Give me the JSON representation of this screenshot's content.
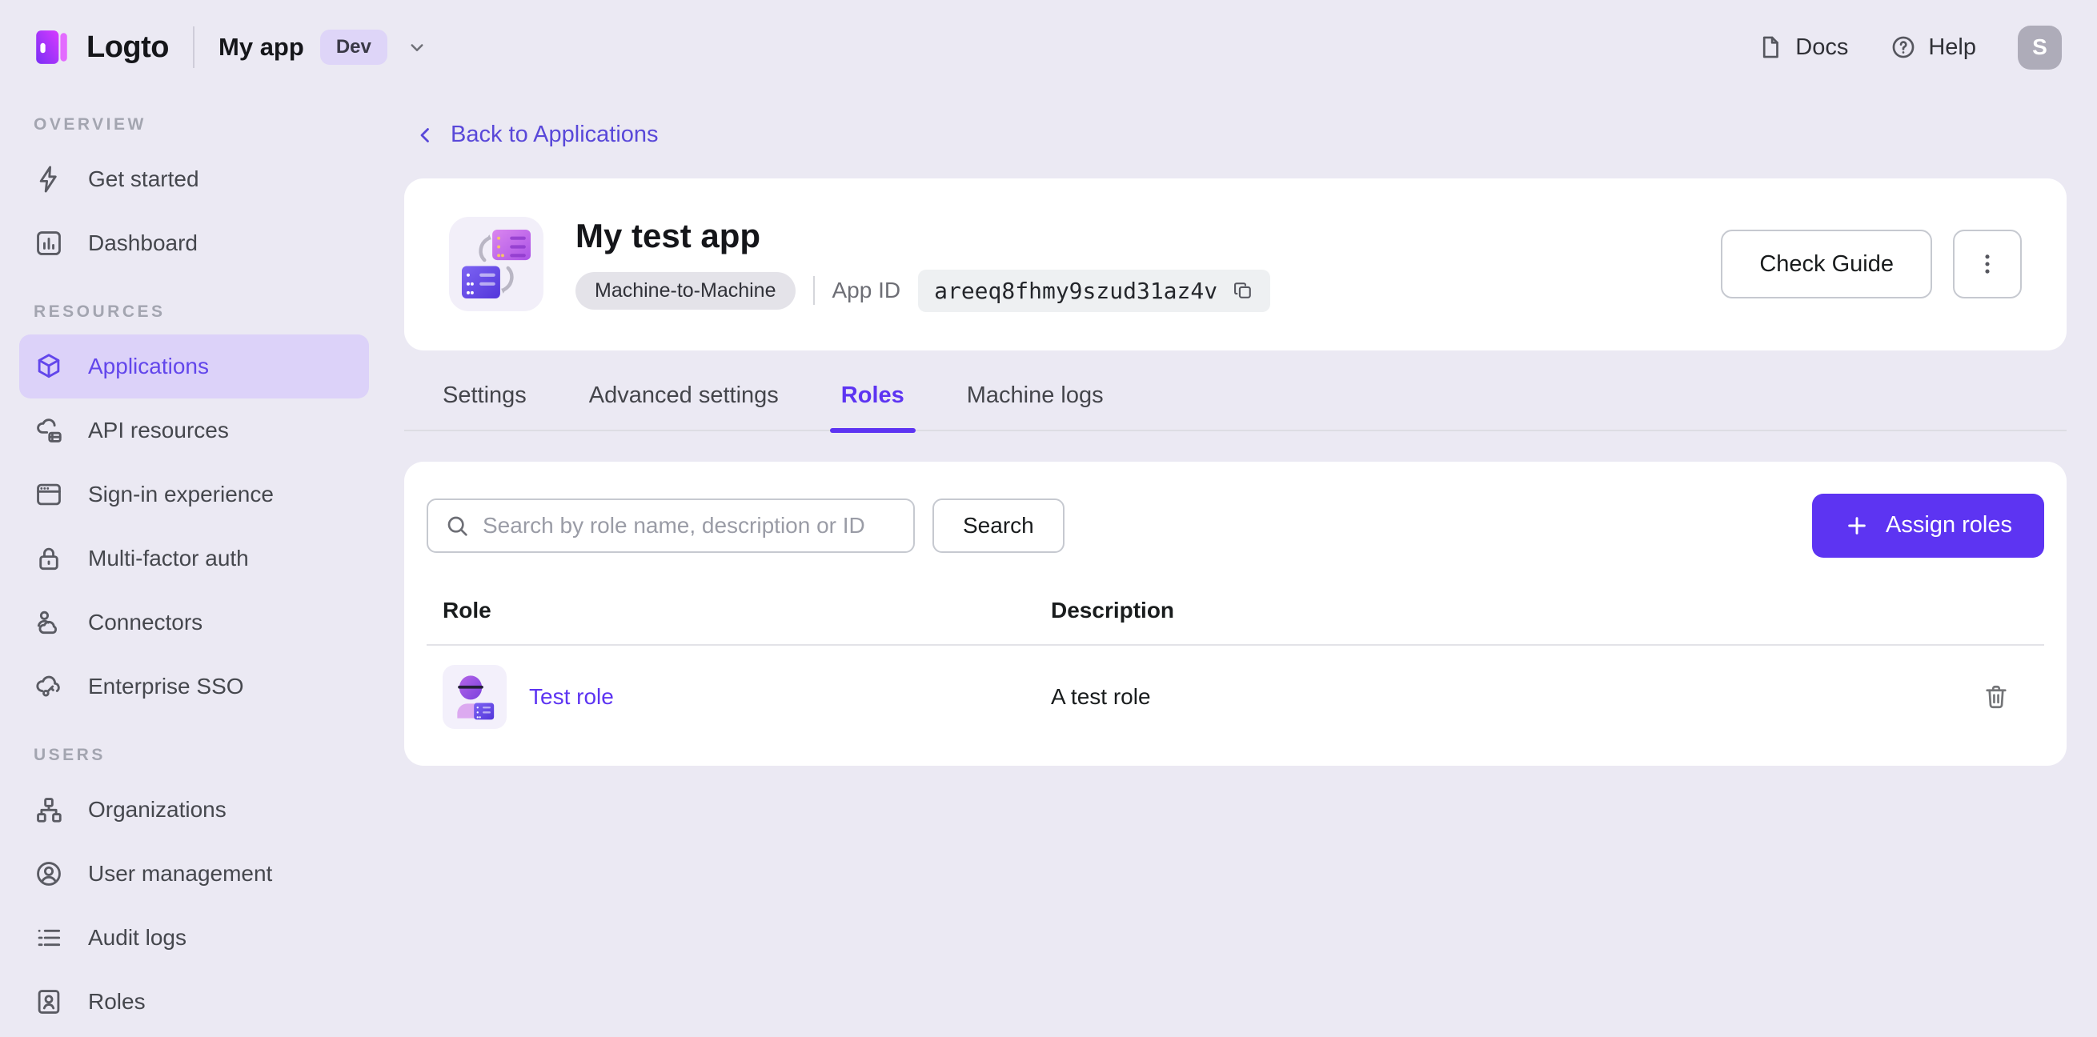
{
  "topbar": {
    "brand": "Logto",
    "app_name": "My app",
    "env_badge": "Dev",
    "docs_label": "Docs",
    "help_label": "Help",
    "avatar_initial": "S"
  },
  "sidebar": {
    "sections": [
      {
        "label": "OVERVIEW",
        "items": [
          {
            "label": "Get started",
            "icon": "lightning-icon"
          },
          {
            "label": "Dashboard",
            "icon": "bar-chart-icon"
          }
        ]
      },
      {
        "label": "RESOURCES",
        "items": [
          {
            "label": "Applications",
            "icon": "cube-icon",
            "active": true
          },
          {
            "label": "API resources",
            "icon": "cloud-server-icon"
          },
          {
            "label": "Sign-in experience",
            "icon": "browser-icon"
          },
          {
            "label": "Multi-factor auth",
            "icon": "lock-icon"
          },
          {
            "label": "Connectors",
            "icon": "person-cloud-icon"
          },
          {
            "label": "Enterprise SSO",
            "icon": "cloud-key-icon"
          }
        ]
      },
      {
        "label": "USERS",
        "items": [
          {
            "label": "Organizations",
            "icon": "org-chart-icon"
          },
          {
            "label": "User management",
            "icon": "user-circle-icon"
          },
          {
            "label": "Audit logs",
            "icon": "list-icon"
          },
          {
            "label": "Roles",
            "icon": "id-card-icon"
          }
        ]
      }
    ]
  },
  "main": {
    "back_link_label": "Back to Applications",
    "app_header": {
      "title": "My test app",
      "type_badge": "Machine-to-Machine",
      "app_id_label": "App ID",
      "app_id_value": "areeq8fhmy9szud31az4v",
      "check_guide_label": "Check Guide"
    },
    "tabs": [
      {
        "label": "Settings"
      },
      {
        "label": "Advanced settings"
      },
      {
        "label": "Roles",
        "active": true
      },
      {
        "label": "Machine logs"
      }
    ],
    "roles_panel": {
      "search_placeholder": "Search by role name, description or ID",
      "search_button_label": "Search",
      "assign_button_label": "Assign roles",
      "table": {
        "headers": [
          "Role",
          "Description"
        ],
        "rows": [
          {
            "role_name": "Test role",
            "description": "A test role"
          }
        ]
      }
    }
  },
  "colors": {
    "accent": "#5d34f2",
    "link": "#5948d9",
    "sidebar_active_bg": "#dcd2f9",
    "sidebar_active_text": "#6246eb",
    "page_bg": "#ebe9f3",
    "card_bg": "#ffffff",
    "type_badge_bg": "#e4e3e9",
    "env_badge_bg": "#ded5f8"
  }
}
